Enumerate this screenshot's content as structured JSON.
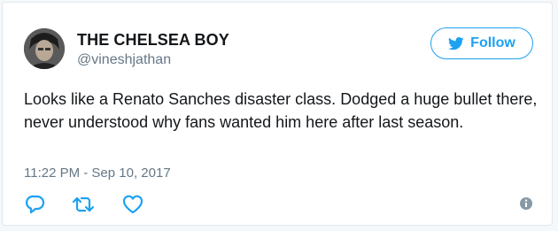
{
  "tweet": {
    "display_name": "THE CHELSEA BOY",
    "username": "@vineshjathan",
    "text": "Looks like a Renato Sanches disaster class. Dodged a huge bullet there, never understood why fans wanted him here after last season.",
    "timestamp": "11:22 PM - Sep 10, 2017"
  },
  "follow_button": {
    "label": "Follow"
  },
  "icons": {
    "follow": "twitter-bird-icon",
    "reply": "reply-icon",
    "retweet": "retweet-icon",
    "like": "heart-icon",
    "info": "info-icon"
  },
  "colors": {
    "accent": "#1da1f2",
    "text": "#14171a",
    "muted": "#657786"
  }
}
